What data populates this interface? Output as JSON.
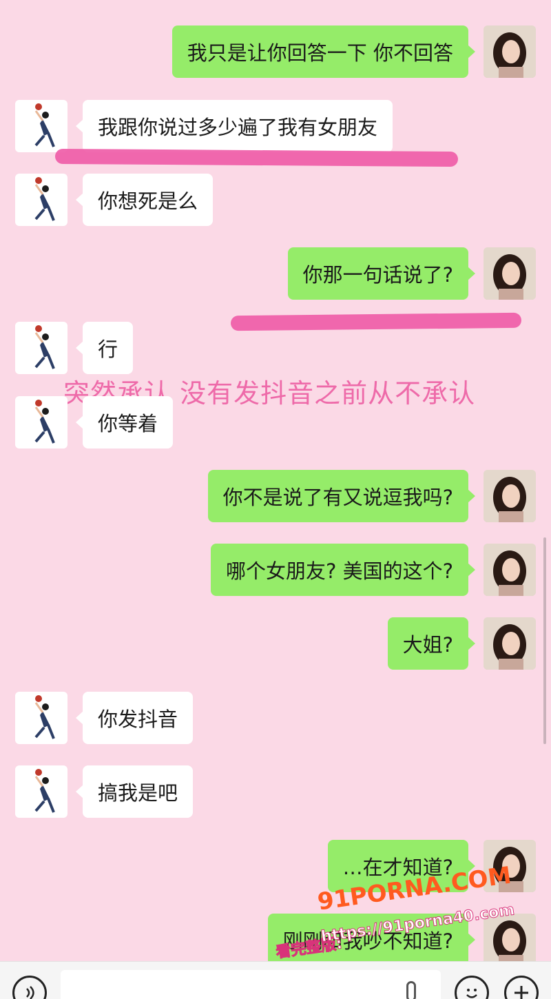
{
  "messages": [
    {
      "side": "out",
      "text": "我只是让你回答一下 你不回答"
    },
    {
      "side": "in",
      "text": "我跟你说过多少遍了我有女朋友"
    },
    {
      "side": "in",
      "text": "你想死是么"
    },
    {
      "side": "out",
      "text": "你那一句话说了?"
    },
    {
      "side": "in",
      "text": "行"
    },
    {
      "side": "in",
      "text": "你等着"
    },
    {
      "side": "out",
      "text": "你不是说了有又说逗我吗?"
    },
    {
      "side": "out",
      "text": "哪个女朋友? 美国的这个?"
    },
    {
      "side": "out",
      "text": "大姐?"
    },
    {
      "side": "in",
      "text": "你发抖音"
    },
    {
      "side": "in",
      "text": "搞我是吧"
    },
    {
      "side": "out",
      "text": "…在才知道?"
    },
    {
      "side": "out",
      "text": "刚刚和我吵不知道?"
    }
  ],
  "annotation": "突然承认 没有发抖音之前从不承认",
  "watermark": {
    "logo": "91PORNA.COM",
    "url": "https://91porna40.com",
    "prefix": "看完整版:"
  },
  "input_bar": {
    "voice_icon": "voice-icon",
    "emoji_icon": "emoji-icon",
    "plus_icon": "plus-icon"
  },
  "colors": {
    "background": "#fbd9e6",
    "out_bubble": "#95ec69",
    "in_bubble": "#ffffff",
    "highlight": "#ee5aa6",
    "annotation": "#ee6aa9"
  }
}
